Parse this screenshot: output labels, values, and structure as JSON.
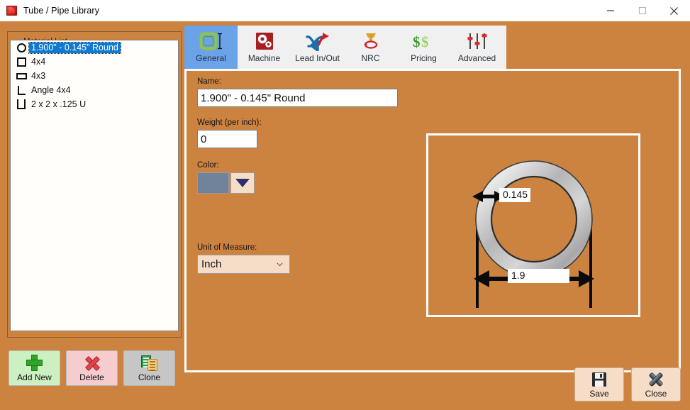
{
  "window": {
    "title": "Tube / Pipe Library",
    "icon": "app-red-document-icon",
    "controls": {
      "minimize": "minimize-icon",
      "maximize": "maximize-icon",
      "close": "close-icon"
    }
  },
  "theme": {
    "background": "#cd8340",
    "tabstrip_bg": "#f0f0f0",
    "active_tab_bg": "#6ba3e8",
    "selection_blue": "#0e7ad4",
    "panel_border": "#fdfdfd",
    "groupbox_border": "#8d5a2b",
    "listbox_bg": "#fffefb"
  },
  "material_list": {
    "group_title": "Material List",
    "items": [
      {
        "label": "1.900\" - 0.145\" Round",
        "icon": "circle-shape-icon",
        "shape": "circle",
        "selected": true
      },
      {
        "label": "4x4",
        "icon": "square-shape-icon",
        "shape": "square",
        "selected": false
      },
      {
        "label": "4x3",
        "icon": "rectangle-shape-icon",
        "shape": "rect",
        "selected": false
      },
      {
        "label": "Angle 4x4",
        "icon": "angle-shape-icon",
        "shape": "angle",
        "selected": false
      },
      {
        "label": "2 x 2 x .125 U",
        "icon": "u-channel-shape-icon",
        "shape": "u",
        "selected": false
      }
    ]
  },
  "list_buttons": [
    {
      "label": "Add New",
      "icon": "plus-icon",
      "color": "#cdf0c2"
    },
    {
      "label": "Delete",
      "icon": "x-cross-icon",
      "color": "#f6ccce"
    },
    {
      "label": "Clone",
      "icon": "copy-documents-icon",
      "color": "#c6c6c6"
    }
  ],
  "tabs": [
    {
      "label": "General",
      "icon": "rounded-square-dimension-icon",
      "active": true
    },
    {
      "label": "Machine",
      "icon": "gears-icon",
      "active": false
    },
    {
      "label": "Lead In/Out",
      "icon": "blue-red-arrows-icon",
      "active": false
    },
    {
      "label": "NRC",
      "icon": "torch-loop-icon",
      "active": false
    },
    {
      "label": "Pricing",
      "icon": "dollar-signs-icon",
      "active": false
    },
    {
      "label": "Advanced",
      "icon": "sliders-icon",
      "active": false
    }
  ],
  "general_tab": {
    "name": {
      "label": "Name:",
      "value": "1.900\" - 0.145\" Round"
    },
    "weight": {
      "label": "Weight (per inch):",
      "value": "0"
    },
    "color": {
      "label": "Color:",
      "swatch_hex": "#70839a",
      "dropdown_icon": "triangle-down-icon"
    },
    "unit_of_measure": {
      "label": "Unit of Measure:",
      "value": "Inch",
      "chevron_icon": "chevron-down-icon"
    }
  },
  "diagram": {
    "shape": "round-tube-cross-section",
    "wall_thickness_label": "0.145",
    "outer_diameter_label": "1.9",
    "wall_arrow_icon": "double-arrow-horizontal-icon",
    "diameter_arrow_icon": "dimension-arrow-icon"
  },
  "footer_buttons": [
    {
      "label": "Save",
      "icon": "floppy-disk-icon"
    },
    {
      "label": "Close",
      "icon": "x-close-icon"
    }
  ]
}
